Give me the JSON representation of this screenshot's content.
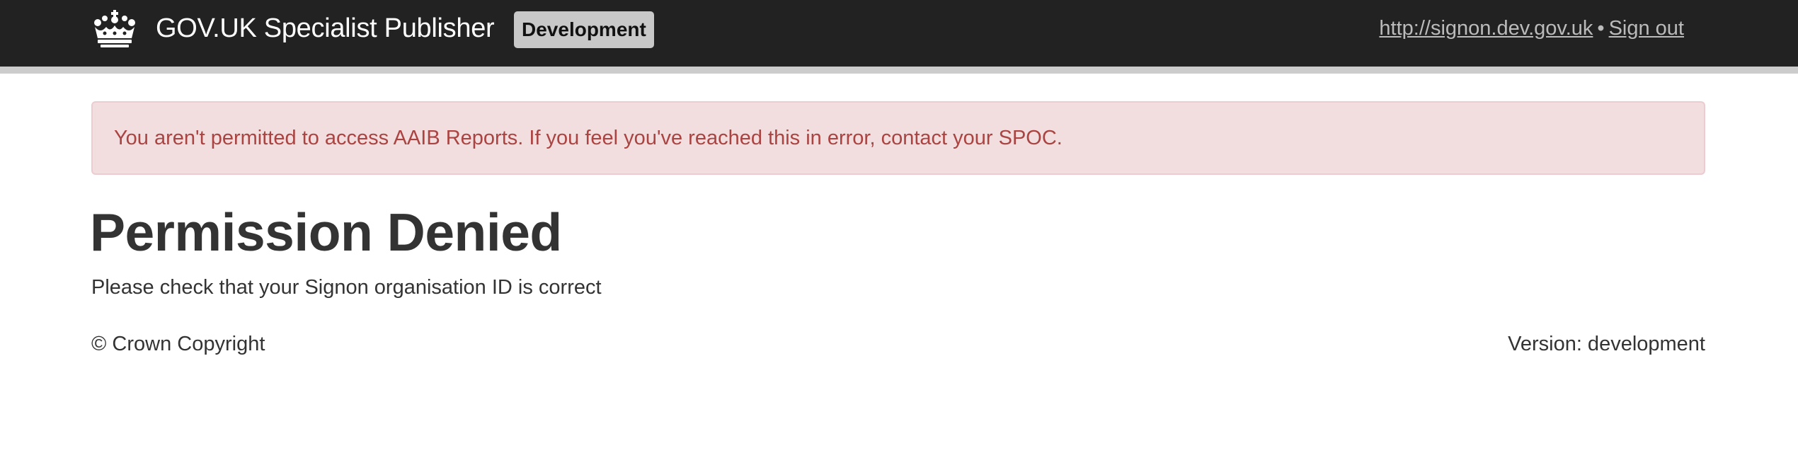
{
  "header": {
    "brand_icon": "crown-icon",
    "brand_label": "GOV.UK Specialist Publisher",
    "environment_badge": "Development",
    "signon_link": "http://signon.dev.gov.uk",
    "separator": "•",
    "sign_out_link": "Sign out",
    "colors": {
      "background": "#222222",
      "badge_background": "#c8c8c8",
      "link": "#bbbbbb"
    }
  },
  "alert": {
    "message": "You aren't permitted to access AAIB Reports. If you feel you've reached this in error, contact your SPOC.",
    "colors": {
      "background": "#f2dede",
      "border": "#ebccd1",
      "text": "#a94442"
    }
  },
  "main": {
    "title": "Permission Denied",
    "body": "Please check that your Signon organisation ID is correct"
  },
  "footer": {
    "copyright": "© Crown Copyright",
    "version": "Version: development"
  }
}
